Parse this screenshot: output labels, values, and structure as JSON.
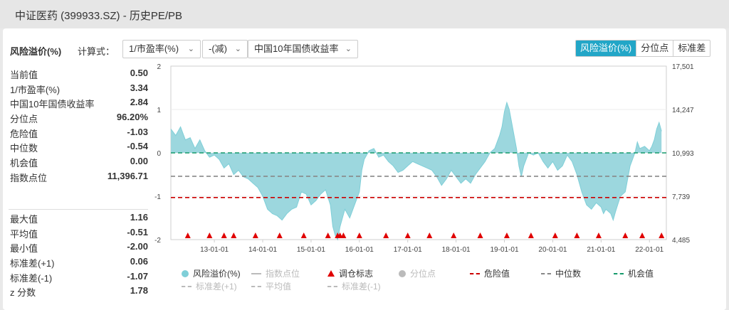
{
  "title": "中证医药 (399933.SZ) - 历史PE/PB",
  "controls": {
    "label": "风险溢价(%)",
    "calc_label": "计算式：",
    "select1": "1/市盈率(%)",
    "select2": "-(减)",
    "select3": "中国10年国债收益率"
  },
  "tabs": [
    "风险溢价(%)",
    "分位点",
    "标准差"
  ],
  "active_tab": 0,
  "stats_top": [
    {
      "k": "当前值",
      "v": "0.50"
    },
    {
      "k": "1/市盈率(%)",
      "v": "3.34"
    },
    {
      "k": "中国10年国债收益率",
      "v": "2.84"
    },
    {
      "k": "分位点",
      "v": "96.20%"
    },
    {
      "k": "危险值",
      "v": "-1.03"
    },
    {
      "k": "中位数",
      "v": "-0.54"
    },
    {
      "k": "机会值",
      "v": "0.00"
    },
    {
      "k": "指数点位",
      "v": "11,396.71"
    }
  ],
  "stats_bottom": [
    {
      "k": "最大值",
      "v": "1.16"
    },
    {
      "k": "平均值",
      "v": "-0.51"
    },
    {
      "k": "最小值",
      "v": "-2.00"
    },
    {
      "k": "标准差(+1)",
      "v": "0.06"
    },
    {
      "k": "标准差(-1)",
      "v": "-1.07"
    },
    {
      "k": "z 分数",
      "v": "1.78"
    }
  ],
  "legend": [
    {
      "label": "风险溢价(%)",
      "kind": "dot",
      "color": "#7fcfd8",
      "active": true
    },
    {
      "label": "指数点位",
      "kind": "line",
      "color": "#bbbbbb",
      "active": false
    },
    {
      "label": "调仓标志",
      "kind": "triangle",
      "color": "#e00000",
      "active": true
    },
    {
      "label": "分位点",
      "kind": "dot",
      "color": "#bbbbbb",
      "active": false
    },
    {
      "label": "危险值",
      "kind": "dash",
      "color": "#cc0000",
      "active": true
    },
    {
      "label": "中位数",
      "kind": "dash",
      "color": "#888888",
      "active": true
    },
    {
      "label": "机会值",
      "kind": "dash",
      "color": "#159a6b",
      "active": true
    },
    {
      "label": "标准差(+1)",
      "kind": "dash",
      "color": "#bbbbbb",
      "active": false
    },
    {
      "label": "平均值",
      "kind": "dash",
      "color": "#bbbbbb",
      "active": false
    },
    {
      "label": "标准差(-1)",
      "kind": "dash",
      "color": "#bbbbbb",
      "active": false
    }
  ],
  "chart_data": {
    "type": "area",
    "x_ticks": [
      "13-01-01",
      "14-01-01",
      "15-01-01",
      "16-01-01",
      "17-01-01",
      "18-01-01",
      "19-01-01",
      "20-01-01",
      "21-01-01",
      "22-01-01"
    ],
    "x_range": [
      2012.1,
      2022.35
    ],
    "ylim": [
      -2,
      2
    ],
    "y_ticks": [
      "2",
      "1",
      "0",
      "-1",
      "-2"
    ],
    "y2_ticks": [
      "17,501",
      "14,247",
      "10,993",
      "7,739",
      "4,485"
    ],
    "area_color": "#9cd7de",
    "area_stroke": "#7fcfd8",
    "series": [
      {
        "name": "风险溢价(%)",
        "points": [
          [
            2012.1,
            0.55
          ],
          [
            2012.2,
            0.4
          ],
          [
            2012.3,
            0.6
          ],
          [
            2012.4,
            0.3
          ],
          [
            2012.5,
            0.35
          ],
          [
            2012.6,
            0.1
          ],
          [
            2012.7,
            0.3
          ],
          [
            2012.8,
            0.05
          ],
          [
            2012.9,
            -0.1
          ],
          [
            2013.0,
            -0.05
          ],
          [
            2013.1,
            -0.15
          ],
          [
            2013.2,
            -0.35
          ],
          [
            2013.3,
            -0.25
          ],
          [
            2013.4,
            -0.5
          ],
          [
            2013.5,
            -0.4
          ],
          [
            2013.6,
            -0.55
          ],
          [
            2013.7,
            -0.6
          ],
          [
            2013.8,
            -0.7
          ],
          [
            2013.9,
            -0.8
          ],
          [
            2014.0,
            -1.0
          ],
          [
            2014.1,
            -1.3
          ],
          [
            2014.2,
            -1.4
          ],
          [
            2014.3,
            -1.45
          ],
          [
            2014.4,
            -1.55
          ],
          [
            2014.5,
            -1.4
          ],
          [
            2014.6,
            -1.3
          ],
          [
            2014.7,
            -1.25
          ],
          [
            2014.8,
            -0.9
          ],
          [
            2014.9,
            -0.95
          ],
          [
            2015.0,
            -1.2
          ],
          [
            2015.1,
            -1.1
          ],
          [
            2015.2,
            -0.95
          ],
          [
            2015.3,
            -0.85
          ],
          [
            2015.4,
            -1.2
          ],
          [
            2015.45,
            -1.7
          ],
          [
            2015.5,
            -1.9
          ],
          [
            2015.55,
            -2.0
          ],
          [
            2015.6,
            -1.7
          ],
          [
            2015.7,
            -1.3
          ],
          [
            2015.8,
            -1.5
          ],
          [
            2015.9,
            -1.2
          ],
          [
            2016.0,
            -0.9
          ],
          [
            2016.05,
            -0.4
          ],
          [
            2016.1,
            -0.15
          ],
          [
            2016.2,
            0.05
          ],
          [
            2016.3,
            0.1
          ],
          [
            2016.4,
            -0.1
          ],
          [
            2016.5,
            -0.05
          ],
          [
            2016.6,
            -0.2
          ],
          [
            2016.7,
            -0.3
          ],
          [
            2016.8,
            -0.45
          ],
          [
            2016.9,
            -0.4
          ],
          [
            2017.0,
            -0.3
          ],
          [
            2017.1,
            -0.2
          ],
          [
            2017.2,
            -0.25
          ],
          [
            2017.3,
            -0.3
          ],
          [
            2017.4,
            -0.35
          ],
          [
            2017.5,
            -0.4
          ],
          [
            2017.6,
            -0.55
          ],
          [
            2017.7,
            -0.75
          ],
          [
            2017.8,
            -0.6
          ],
          [
            2017.9,
            -0.4
          ],
          [
            2018.0,
            -0.55
          ],
          [
            2018.1,
            -0.7
          ],
          [
            2018.2,
            -0.6
          ],
          [
            2018.3,
            -0.7
          ],
          [
            2018.4,
            -0.5
          ],
          [
            2018.5,
            -0.35
          ],
          [
            2018.6,
            -0.2
          ],
          [
            2018.7,
            0.0
          ],
          [
            2018.8,
            0.1
          ],
          [
            2018.9,
            0.4
          ],
          [
            2018.95,
            0.6
          ],
          [
            2019.0,
            0.95
          ],
          [
            2019.05,
            1.16
          ],
          [
            2019.1,
            1.0
          ],
          [
            2019.2,
            0.4
          ],
          [
            2019.25,
            0.1
          ],
          [
            2019.3,
            -0.3
          ],
          [
            2019.35,
            -0.55
          ],
          [
            2019.4,
            -0.3
          ],
          [
            2019.5,
            0.0
          ],
          [
            2019.6,
            -0.05
          ],
          [
            2019.7,
            0.0
          ],
          [
            2019.8,
            -0.2
          ],
          [
            2019.9,
            -0.35
          ],
          [
            2020.0,
            -0.2
          ],
          [
            2020.1,
            -0.4
          ],
          [
            2020.2,
            -0.3
          ],
          [
            2020.3,
            -0.05
          ],
          [
            2020.4,
            -0.2
          ],
          [
            2020.5,
            -0.5
          ],
          [
            2020.6,
            -0.9
          ],
          [
            2020.7,
            -1.2
          ],
          [
            2020.8,
            -1.3
          ],
          [
            2020.9,
            -1.15
          ],
          [
            2021.0,
            -1.25
          ],
          [
            2021.05,
            -1.4
          ],
          [
            2021.1,
            -1.3
          ],
          [
            2021.2,
            -1.4
          ],
          [
            2021.25,
            -1.55
          ],
          [
            2021.3,
            -1.35
          ],
          [
            2021.4,
            -1.0
          ],
          [
            2021.5,
            -0.9
          ],
          [
            2021.6,
            -0.3
          ],
          [
            2021.7,
            0.0
          ],
          [
            2021.75,
            0.25
          ],
          [
            2021.8,
            0.1
          ],
          [
            2021.9,
            0.15
          ],
          [
            2022.0,
            0.05
          ],
          [
            2022.05,
            0.15
          ],
          [
            2022.1,
            0.3
          ],
          [
            2022.15,
            0.55
          ],
          [
            2022.2,
            0.7
          ],
          [
            2022.25,
            0.5
          ]
        ]
      },
      {
        "name": "危险值",
        "value": -1.03
      },
      {
        "name": "中位数",
        "value": -0.54
      },
      {
        "name": "机会值",
        "value": 0.0
      }
    ],
    "markers_x": [
      2012.45,
      2012.9,
      2013.2,
      2013.4,
      2013.85,
      2014.35,
      2014.85,
      2015.35,
      2015.55,
      2015.6,
      2015.67,
      2016.0,
      2016.55,
      2017.0,
      2017.45,
      2017.95,
      2018.5,
      2019.05,
      2019.55,
      2020.05,
      2020.5,
      2020.95,
      2021.5,
      2021.85,
      2022.25
    ]
  }
}
